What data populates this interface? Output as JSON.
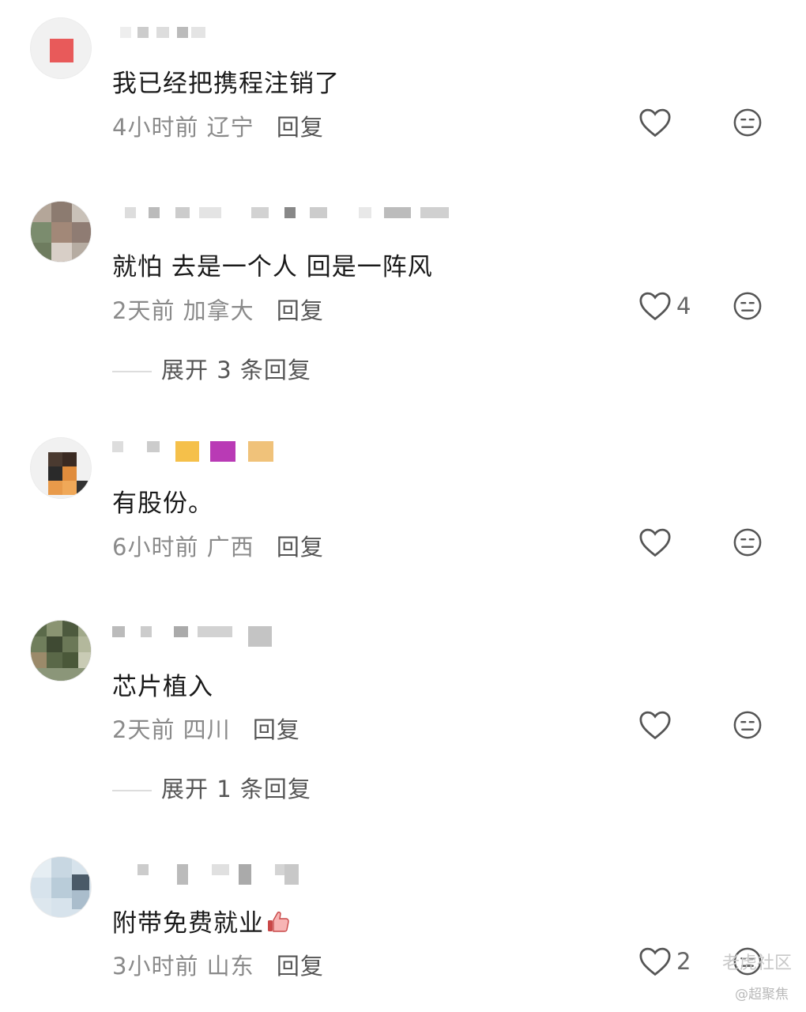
{
  "comments": [
    {
      "text": "我已经把携程注销了",
      "time": "4小时前",
      "location": "辽宁",
      "reply": "回复",
      "likes": ""
    },
    {
      "text": "就怕 去是一个人 回是一阵风",
      "time": "2天前",
      "location": "加拿大",
      "reply": "回复",
      "likes": "4",
      "expand": "展开 3 条回复"
    },
    {
      "text": "有股份。",
      "time": "6小时前",
      "location": "广西",
      "reply": "回复",
      "likes": ""
    },
    {
      "text": "芯片植入",
      "time": "2天前",
      "location": "四川",
      "reply": "回复",
      "likes": "",
      "expand": "展开 1 条回复"
    },
    {
      "text": "附带免费就业",
      "time": "3小时前",
      "location": "山东",
      "reply": "回复",
      "likes": "2"
    }
  ],
  "watermark": {
    "main": "老虎社区",
    "sub": "@超聚焦"
  },
  "colors": {
    "text": "#1a1a1a",
    "meta": "#8a8a8a",
    "icon": "#555555"
  }
}
